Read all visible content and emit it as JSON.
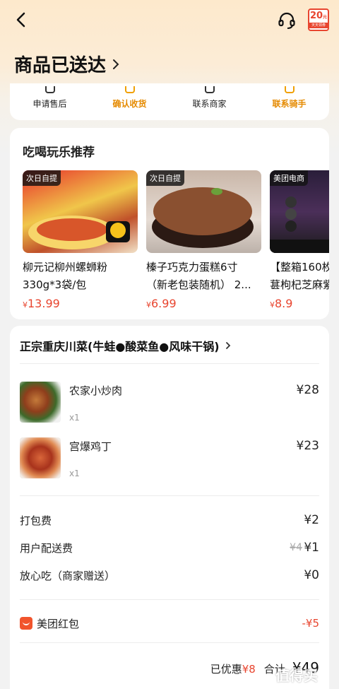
{
  "header": {
    "coupon_amount": "20",
    "coupon_unit": "元",
    "coupon_sub": "天天领券",
    "status_title": "商品已送达"
  },
  "actions": [
    {
      "label": "申请售后"
    },
    {
      "label": "确认收货"
    },
    {
      "label": "联系商家"
    },
    {
      "label": "联系骑手"
    }
  ],
  "recommend": {
    "title": "吃喝玩乐推荐",
    "items": [
      {
        "badge": "次日自提",
        "name_line1": "柳元记柳州螺蛳粉",
        "name_line2": "330g*3袋/包",
        "currency": "¥",
        "price": "13.99"
      },
      {
        "badge": "次日自提",
        "name_line1": "榛子巧克力蛋糕6寸",
        "name_line2": "（新老包装随机） 2...",
        "currency": "¥",
        "price": "6.99"
      },
      {
        "badge": "美团电商",
        "name_line1": "【整箱160枚",
        "name_line2": "葚枸杞芝麻紫",
        "currency": "¥",
        "price": "8.9"
      }
    ]
  },
  "order": {
    "store_name": "正宗重庆川菜(牛蛙●酸菜鱼●风味干锅)",
    "dishes": [
      {
        "name": "农家小炒肉",
        "qty": "x1",
        "price": "¥28"
      },
      {
        "name": "宫爆鸡丁",
        "qty": "x1",
        "price": "¥23"
      }
    ],
    "fees": [
      {
        "label": "打包费",
        "original": "",
        "value": "¥2"
      },
      {
        "label": "用户配送费",
        "original": "¥4",
        "value": "¥1"
      },
      {
        "label": "放心吃（商家赠送）",
        "original": "",
        "value": "¥0"
      }
    ],
    "hongbao": {
      "label": "美团红包",
      "value": "-¥5"
    },
    "summary": {
      "discount_label": "已优惠",
      "discount_value": "¥8",
      "total_label": "合计",
      "total_value": "¥49"
    }
  },
  "watermark": "值得买",
  "colors": {
    "accent_orange": "#e58a00",
    "price_red": "#e8452f"
  }
}
